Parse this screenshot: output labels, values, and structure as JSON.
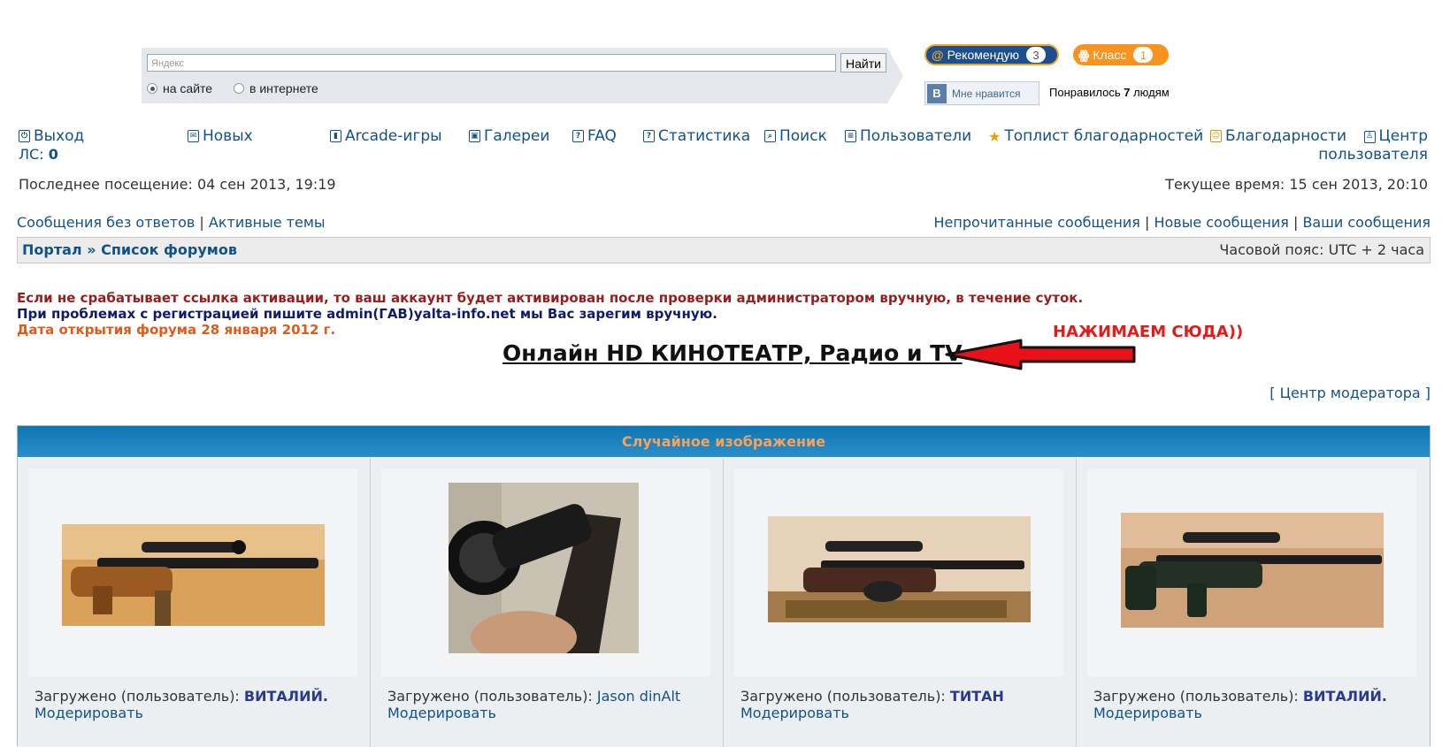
{
  "search": {
    "placeholder": "Яндекс",
    "button": "Найти",
    "radio_site": "на сайте",
    "radio_web": "в интернете"
  },
  "social": {
    "mailru_label": "Рекомендую",
    "mailru_count": "3",
    "ok_label": "Класс",
    "ok_count": "1",
    "vk_label": "Мне нравится",
    "liked_prefix": "Понравилось ",
    "liked_count": "7",
    "liked_suffix": " людям"
  },
  "nav": {
    "logout": "Выход",
    "pm": "ЛС: ",
    "pm_count": "0",
    "new": "Новых",
    "arcade": "Arcade-игры",
    "galleries": "Галереи",
    "faq": "FAQ",
    "stats": "Статистика",
    "search": "Поиск",
    "users": "Пользователи",
    "toplist": "Топлист благодарностей",
    "thanks": "Благодарности",
    "ucp_line1": "Центр",
    "ucp_line2": "пользователя"
  },
  "info": {
    "last_visit": "Последнее посещение: 04 сен 2013, 19:19",
    "current_time": "Текущее время: 15 сен 2013, 20:10"
  },
  "links": {
    "unanswered": "Сообщения без ответов",
    "active": "Активные темы",
    "unread": "Непрочитанные сообщения",
    "new_posts": "Новые сообщения",
    "your_posts": "Ваши сообщения",
    "sep": " | "
  },
  "breadcrumb": {
    "portal": "Портал",
    "sep": " » ",
    "forums": "Список форумов",
    "timezone": "Часовой пояс: UTC + 2 часа"
  },
  "notices": {
    "line1": "Если не срабатывает ссылка активации, то ваш аккаунт будет активирован после проверки администратором вручную, в течение суток.",
    "line2": "При проблемах с регистрацией пишите admin(ГАВ)yalta-info.net мы Вас зарегим вручную.",
    "line3": "Дата открытия форума 28 января 2012 г.",
    "cinema": "Онлайн HD КИНОТЕАТР, Радио и TV",
    "click_here": "НАЖИМАЕМ СЮДА))",
    "mcp": "[ Центр модератора ]"
  },
  "colors": {
    "line1": "#9b1c1c",
    "line2": "#101c6b",
    "line3": "#e05a1a",
    "click_here": "#e21b1b",
    "arrow": "#e8111a"
  },
  "gallery": {
    "title": "Случайное изображение",
    "uploaded_label": "Загружено (пользователь): ",
    "moderate": "Модерировать",
    "items": [
      {
        "user": "ВИТАЛИЙ."
      },
      {
        "user": "Jason dinAlt"
      },
      {
        "user": "ТИТАН"
      },
      {
        "user": "ВИТАЛИЙ."
      }
    ]
  }
}
